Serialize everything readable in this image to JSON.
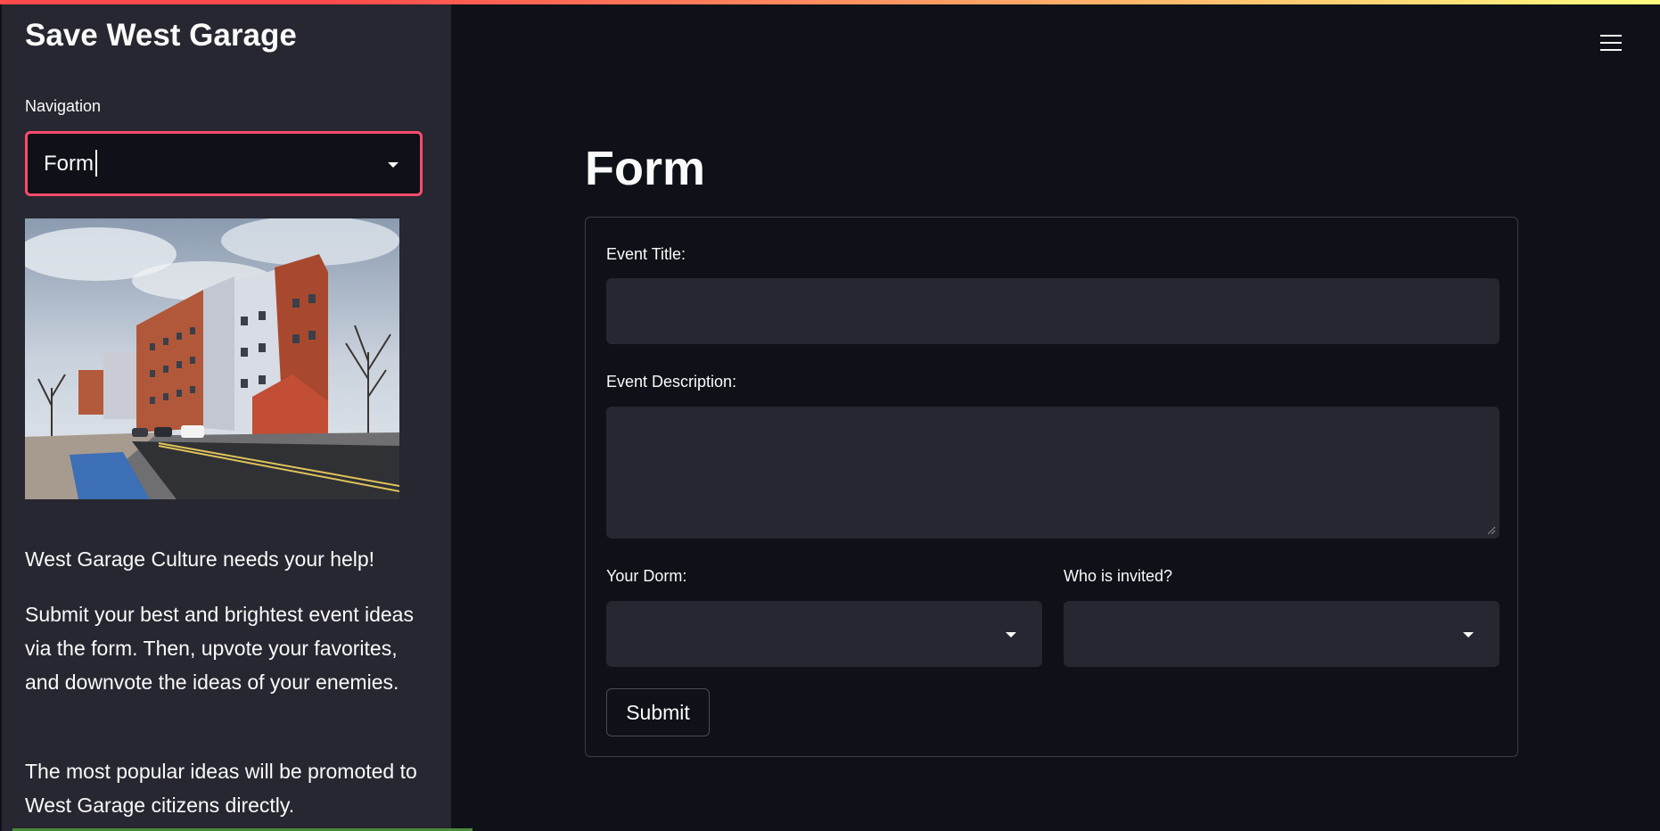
{
  "sidebar": {
    "title": "Save West Garage",
    "navigation_label": "Navigation",
    "navigation_value": "Form",
    "paragraphs": [
      "West Garage Culture needs your help!",
      "Submit your best and brightest event ideas via the form. Then, upvote your favorites, and downvote the ideas of your enemies.",
      "The most popular ideas will be promoted to West Garage citizens directly."
    ]
  },
  "header": {
    "menu_icon": "hamburger-menu-icon"
  },
  "main": {
    "title": "Form",
    "form": {
      "event_title_label": "Event Title:",
      "event_title_value": "",
      "event_description_label": "Event Description:",
      "event_description_value": "",
      "dorm_label": "Your Dorm:",
      "dorm_value": "",
      "invited_label": "Who is invited?",
      "invited_value": "",
      "submit_label": "Submit"
    }
  },
  "colors": {
    "background": "#0e1117",
    "sidebar": "#262730",
    "input_bg": "#262730",
    "focus_border": "#ff4b6b",
    "accent": "#ff4b4b"
  }
}
